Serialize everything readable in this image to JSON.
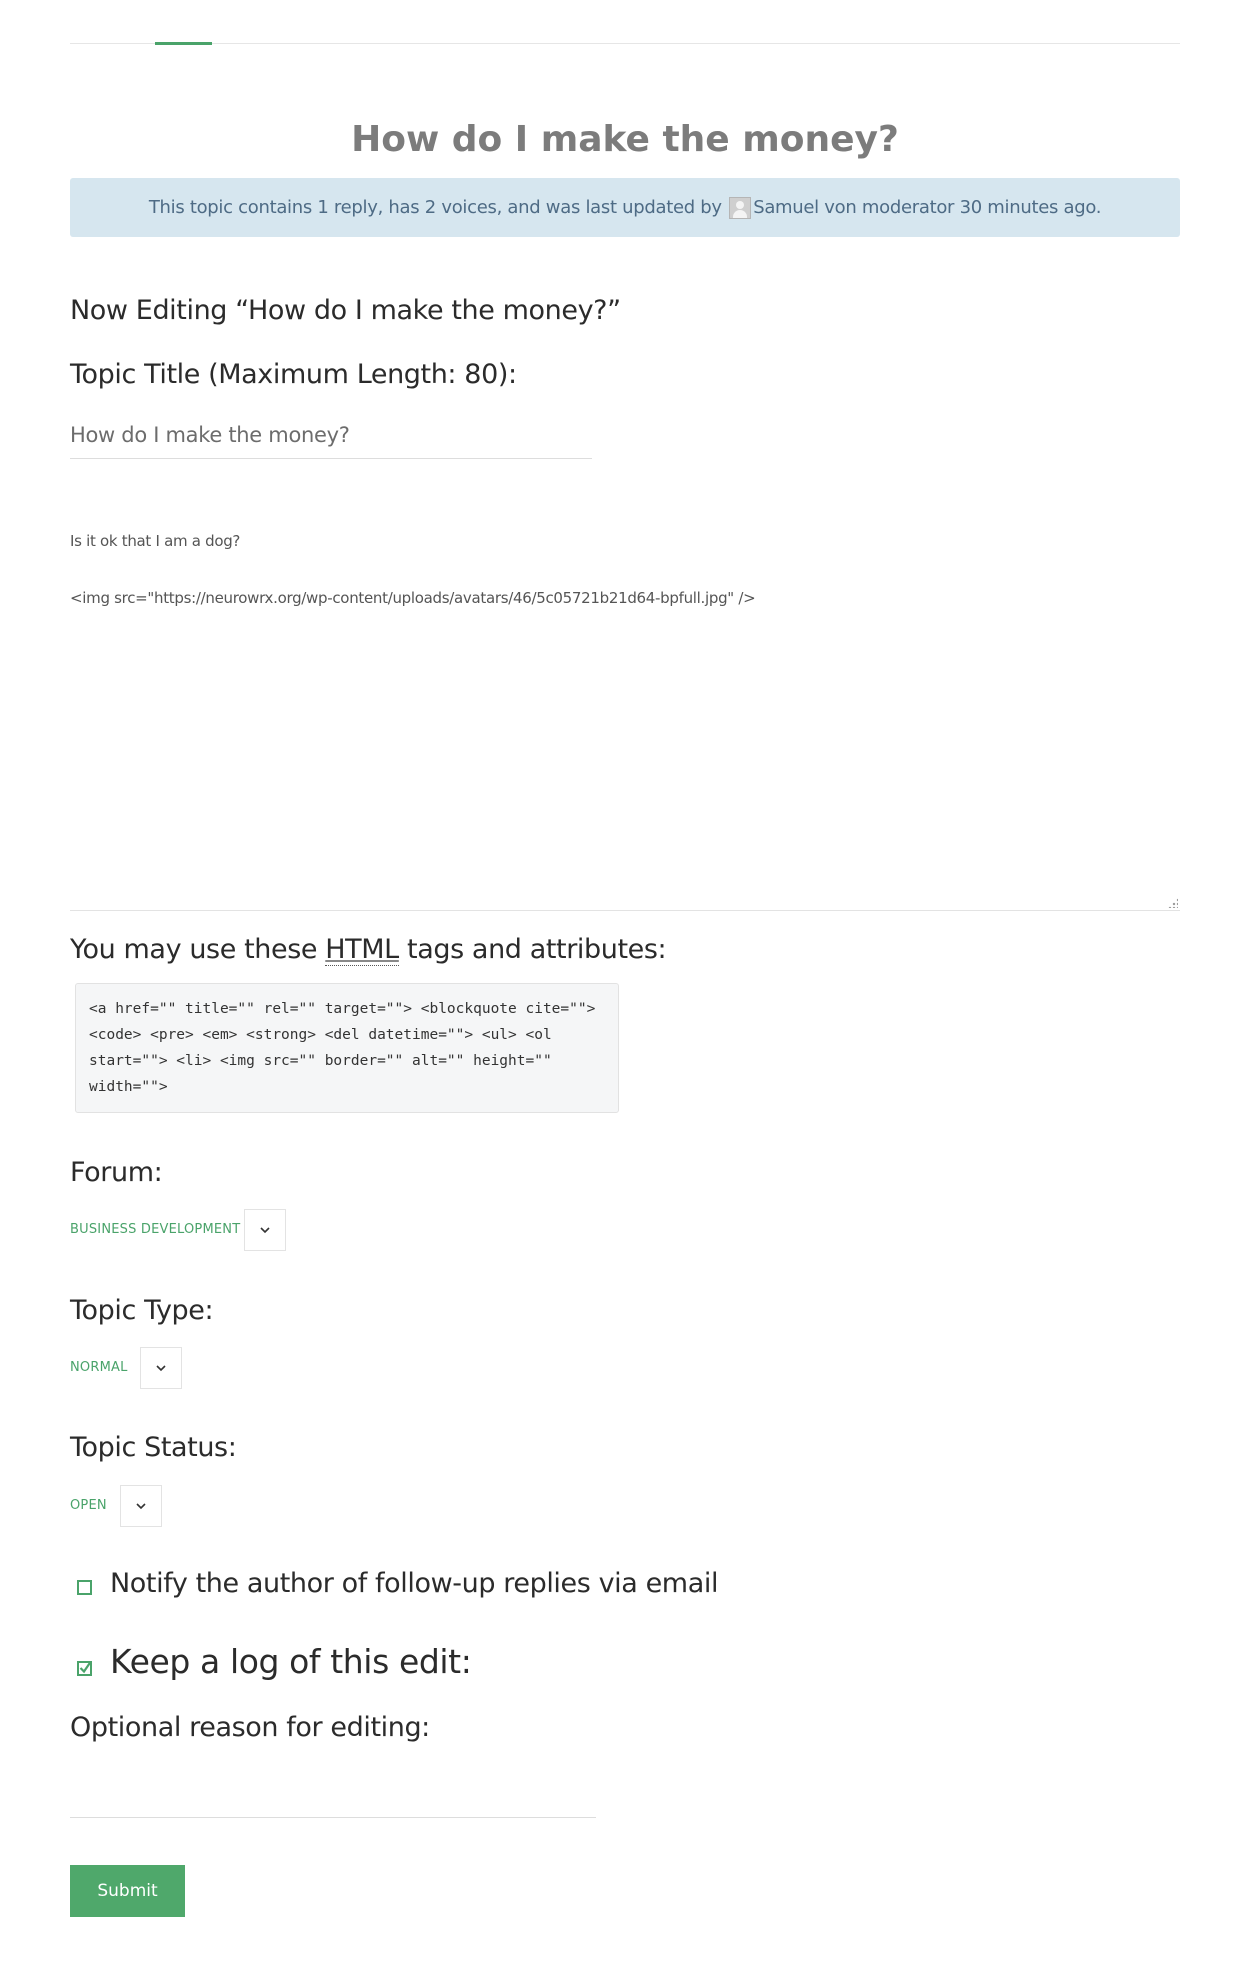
{
  "topic": {
    "title": "How do I make the money?",
    "notice_before": "This topic contains 1 reply, has 2 voices, and was last updated by",
    "notice_author": "Samuel von moderator",
    "notice_after": "30 minutes ago."
  },
  "editor": {
    "heading": "Now Editing “How do I make the money?”",
    "title_label": "Topic Title (Maximum Length: 80):",
    "title_value": "How do I make the money?",
    "content_line1": "Is it ok that I am a dog?",
    "content_line2": "<img src=\"https://neurowrx.org/wp-content/uploads/avatars/46/5c05721b21d64-bpfull.jpg\" />",
    "allowed_prefix": "You may use these",
    "allowed_abbr": "HTML",
    "allowed_suffix": "tags and attributes:",
    "allowed_tags": "<a href=\"\" title=\"\" rel=\"\" target=\"\"> <blockquote cite=\"\">\n<code> <pre> <em> <strong> <del datetime=\"\"> <ul> <ol\nstart=\"\"> <li> <img src=\"\" border=\"\" alt=\"\" height=\"\"\nwidth=\"\">"
  },
  "fields": {
    "forum_label": "Forum:",
    "forum_value": "BUSINESS DEVELOPMENT",
    "type_label": "Topic Type:",
    "type_value": "NORMAL",
    "status_label": "Topic Status:",
    "status_value": "OPEN"
  },
  "options": {
    "notify_label": "Notify the author of follow-up replies via email",
    "notify_checked": false,
    "log_label": "Keep a log of this edit:",
    "log_checked": true,
    "reason_label": "Optional reason for editing:",
    "reason_value": ""
  },
  "actions": {
    "submit_label": "Submit"
  },
  "colors": {
    "accent": "#4aa36a",
    "notice_bg": "#d6e6ef",
    "notice_text": "#4e6b85"
  }
}
